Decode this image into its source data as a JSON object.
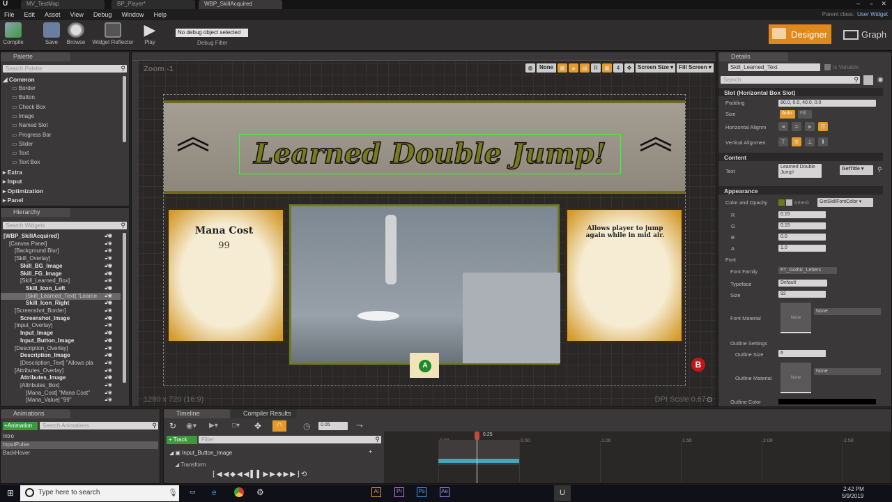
{
  "tabs": [
    "MV_TestMap",
    "BP_Player*",
    "WBP_SkillAcquired"
  ],
  "menu": [
    "File",
    "Edit",
    "Asset",
    "View",
    "Debug",
    "Window",
    "Help"
  ],
  "parent_class_label": "Parent class:",
  "parent_class": "User Widget",
  "toolbar": {
    "compile": "Compile",
    "save": "Save",
    "browse": "Browse",
    "widget_reflector": "Widget Reflector",
    "play": "Play",
    "debug_select": "No debug object selected",
    "debug_filter": "Debug Filter"
  },
  "modes": {
    "designer": "Designer",
    "graph": "Graph"
  },
  "palette": {
    "title": "Palette",
    "search_placeholder": "Search Palette",
    "common": "Common",
    "items": [
      "Border",
      "Button",
      "Check Box",
      "Image",
      "Named Slot",
      "Progress Bar",
      "Slider",
      "Text",
      "Text Box"
    ],
    "categories": [
      "Extra",
      "Input",
      "Optimization",
      "Panel"
    ]
  },
  "hierarchy": {
    "title": "Hierarchy",
    "search_placeholder": "Search Widgets",
    "items": [
      {
        "label": "[WBP_SkillAcquired]",
        "depth": 0,
        "bold": true
      },
      {
        "label": "[Canvas Panel]",
        "depth": 1
      },
      {
        "label": "[Background Blur]",
        "depth": 2
      },
      {
        "label": "[Skill_Overlay]",
        "depth": 2
      },
      {
        "label": "Skill_BG_Image",
        "depth": 3,
        "bold": true
      },
      {
        "label": "Skill_FG_Image",
        "depth": 3,
        "bold": true
      },
      {
        "label": "[Skill_Learned_Box]",
        "depth": 3
      },
      {
        "label": "Skill_Icon_Left",
        "depth": 4,
        "bold": true
      },
      {
        "label": "[Skill_Learned_Text] \"Learne",
        "depth": 4,
        "selected": true
      },
      {
        "label": "Skill_Icon_Right",
        "depth": 4,
        "bold": true
      },
      {
        "label": "[Screenshot_Border]",
        "depth": 2
      },
      {
        "label": "Screenshot_Image",
        "depth": 3,
        "bold": true
      },
      {
        "label": "[Input_Overlay]",
        "depth": 2
      },
      {
        "label": "Input_Image",
        "depth": 3,
        "bold": true
      },
      {
        "label": "Input_Button_Image",
        "depth": 3,
        "bold": true
      },
      {
        "label": "[Description_Overlay]",
        "depth": 2
      },
      {
        "label": "Description_Image",
        "depth": 3,
        "bold": true
      },
      {
        "label": "[Description_Text] \"Allows pla",
        "depth": 3
      },
      {
        "label": "[Attributes_Overlay]",
        "depth": 2
      },
      {
        "label": "Attributes_Image",
        "depth": 3,
        "bold": true
      },
      {
        "label": "[Attributes_Box]",
        "depth": 3
      },
      {
        "label": "[Mana_Cost] \"Mana Cost\"",
        "depth": 4
      },
      {
        "label": "[Mana_Value] \"99\"",
        "depth": 4
      }
    ]
  },
  "designer": {
    "zoom": "Zoom -1",
    "resolution": "1280 x 720 (16:9)",
    "dpi": "DPI Scale 0.67",
    "toolbar": {
      "none": "None",
      "r": "R",
      "grid": "4",
      "screen_size": "Screen Size",
      "fill_screen": "Fill Screen"
    },
    "widget": {
      "title": "Learned Double Jump!",
      "mana_cost": "Mana Cost",
      "mana_value": "99",
      "description": "Allows player to jump again while in mid air.",
      "input_button": "A",
      "back_button": "B"
    }
  },
  "details": {
    "title": "Details",
    "name": "Skill_Learned_Text",
    "is_variable": "Is Variable",
    "search_placeholder": "Search",
    "slot_header": "Slot (Horizontal Box Slot)",
    "padding_label": "Padding",
    "padding": "80.0, 0.0, 40.0, 0.0",
    "size_label": "Size",
    "size_auto": "Auto",
    "size_fill": "Fill",
    "halign": "Horizontal Alignm",
    "valign": "Vertical Alignmen",
    "content_header": "Content",
    "text_label": "Text",
    "text_value": "Learned Double Jump!",
    "text_binding": "GetTitle",
    "appearance_header": "Appearance",
    "color_label": "Color and Opacity",
    "inherit": "Inherit",
    "color_binding": "GetSkillFontColor",
    "r": "0.15",
    "g": "0.15",
    "b": "0.0",
    "a": "1.0",
    "r_label": "R",
    "g_label": "G",
    "b_label": "B",
    "a_label": "A",
    "font_label": "Font",
    "font_family_label": "Font Family",
    "font_family": "FT_Gothic_Letters",
    "typeface_label": "Typeface",
    "typeface": "Default",
    "size_value_label": "Size",
    "font_size": "92",
    "font_material_label": "Font Material",
    "none": "None",
    "outline_settings": "Outline Settings",
    "outline_size_label": "Outline Size",
    "outline_size": "6",
    "outline_material_label": "Outline Material",
    "outline_color_label": "Outline Color"
  },
  "animations": {
    "title": "Animations",
    "add": "+Animation",
    "search_placeholder": "Search Animations",
    "items": [
      "Intro",
      "InputPulse",
      "BackHover"
    ],
    "selected": "InputPulse"
  },
  "timeline": {
    "title": "Timeline",
    "compiler_results": "Compiler Results",
    "snap": "0.05",
    "track": "+ Track",
    "filter_placeholder": "Filter",
    "track_item": "Input_Button_Image",
    "sub_track": "Transform",
    "current_time": "0.25",
    "ticks": [
      "0.00",
      "0.50",
      "1.00",
      "1.50",
      "2.00",
      "2.50"
    ]
  },
  "taskbar": {
    "search_placeholder": "Type here to search",
    "time": "2:42 PM",
    "date": "5/9/2019"
  },
  "colors": {
    "accent": "#e59a2a",
    "green": "#4caf50",
    "title_fill": "#7a7a1e"
  }
}
